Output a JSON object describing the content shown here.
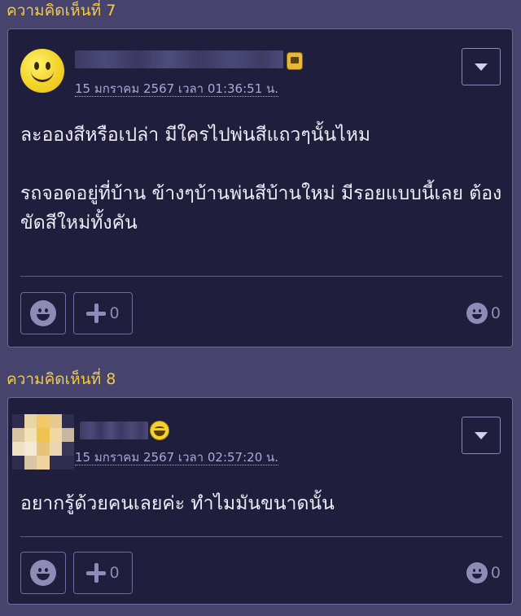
{
  "comments": [
    {
      "label": "ความคิดเห็นที่ 7",
      "timestamp": "15 มกราคม 2567 เวลา 01:36:51 น.",
      "avatar_icon": "smiley-face-icon",
      "badge_icon": "tv-badge-icon",
      "text": "ละอองสีหรือเปล่า มีใครไปพ่นสีแถวๆนั้นไหม\n\nรถจอดอยู่ที่บ้าน ข้างๆบ้านพ่นสีบ้านใหม่ มีรอยแบบนี้เลย ต้องขัดสีใหม่ทั้งคัน",
      "plus_count": "0",
      "emotion_count": "0"
    },
    {
      "label": "ความคิดเห็นที่ 8",
      "timestamp": "15 มกราคม 2567 เวลา 02:57:20 น.",
      "avatar_icon": "pixelated-avatar-icon",
      "badge_icon": "laughing-face-badge-icon",
      "text": "อยากรู้ด้วยคนเลยค่ะ ทำไมมันขนาดนั้น",
      "plus_count": "0",
      "emotion_count": "0"
    }
  ],
  "colors": {
    "background": "#46446c",
    "card": "#1f1e3d",
    "label": "#f3c94a",
    "timestamp": "#a9a9d8",
    "muted_icon": "#8e8cb6"
  }
}
